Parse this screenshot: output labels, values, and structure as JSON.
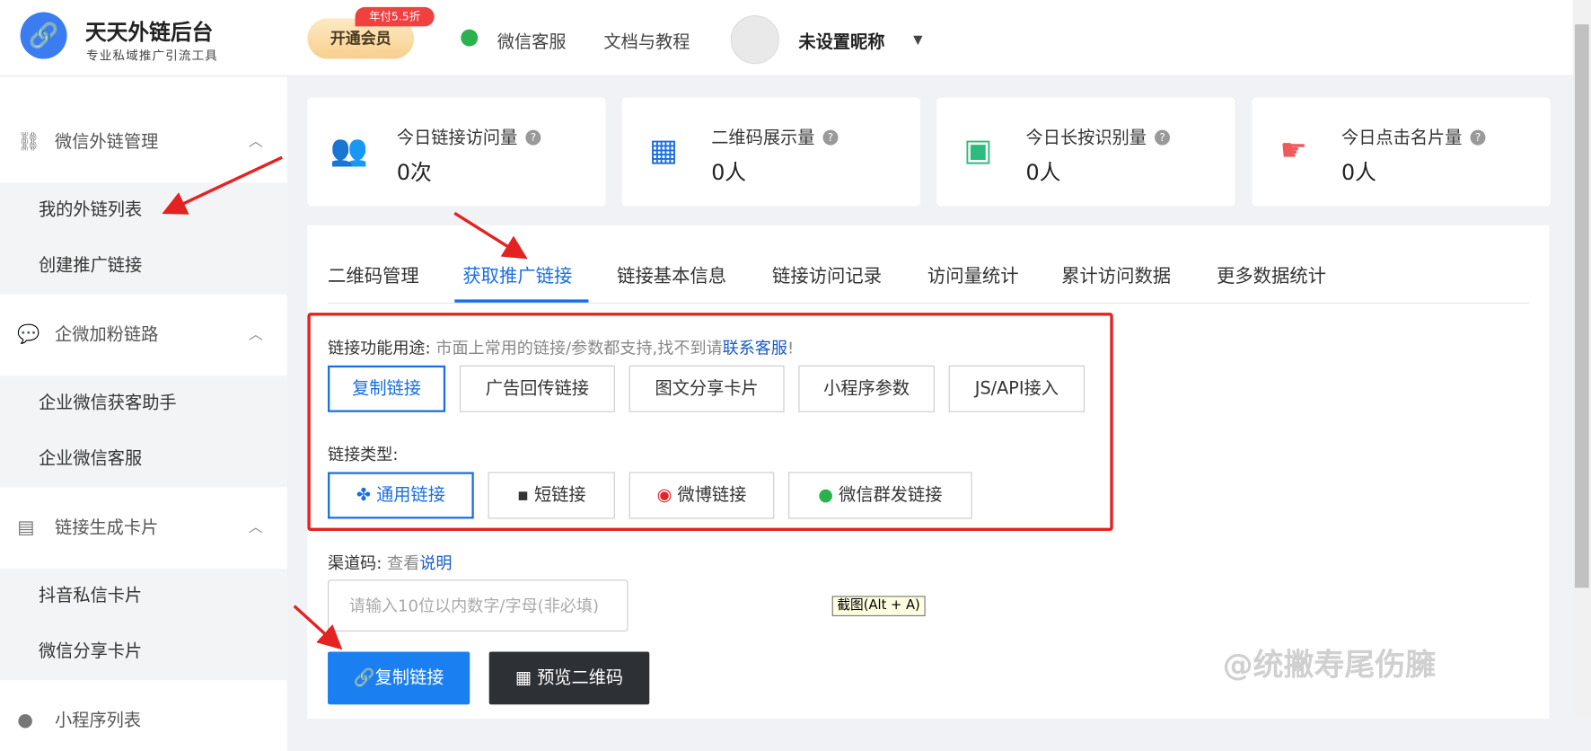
{
  "header": {
    "brand": "天天外链后台",
    "brand_sub": "专业私域推广引流工具",
    "vip_label": "开通会员",
    "vip_badge": "年付5.5折",
    "wechat_service": "微信客服",
    "docs": "文档与教程",
    "username": "未设置昵称"
  },
  "sidebar": {
    "groups": [
      {
        "label": "微信外链管理",
        "items": [
          "我的外链列表",
          "创建推广链接"
        ]
      },
      {
        "label": "企微加粉链路",
        "items": [
          "企业微信获客助手",
          "企业微信客服"
        ]
      },
      {
        "label": "链接生成卡片",
        "items": [
          "抖音私信卡片",
          "微信分享卡片"
        ]
      },
      {
        "label": "小程序列表",
        "items": []
      }
    ]
  },
  "stats": [
    {
      "label": "今日链接访问量",
      "value": "0次"
    },
    {
      "label": "二维码展示量",
      "value": "0人"
    },
    {
      "label": "今日长按识别量",
      "value": "0人"
    },
    {
      "label": "今日点击名片量",
      "value": "0人"
    }
  ],
  "tabs": [
    "二维码管理",
    "获取推广链接",
    "链接基本信息",
    "链接访问记录",
    "访问量统计",
    "累计访问数据",
    "更多数据统计"
  ],
  "purpose": {
    "label": "链接功能用途:",
    "hint": "市面上常用的链接/参数都支持,找不到请",
    "contact": "联系客服",
    "bang": "!",
    "options": [
      "复制链接",
      "广告回传链接",
      "图文分享卡片",
      "小程序参数",
      "JS/API接入"
    ]
  },
  "link_type": {
    "label": "链接类型:",
    "options": [
      "通用链接",
      "短链接",
      "微博链接",
      "微信群发链接"
    ]
  },
  "channel": {
    "label": "渠道码:",
    "view": "查看",
    "explain": "说明",
    "placeholder": "请输入10位以内数字/字母(非必填)"
  },
  "tooltip": "截图(Alt + A)",
  "actions": {
    "copy": "复制链接",
    "preview": "预览二维码"
  },
  "watermark": "@统撇寿尾伤臃",
  "colors": {
    "accent": "#1a6ee0",
    "highlight": "#e42222"
  }
}
